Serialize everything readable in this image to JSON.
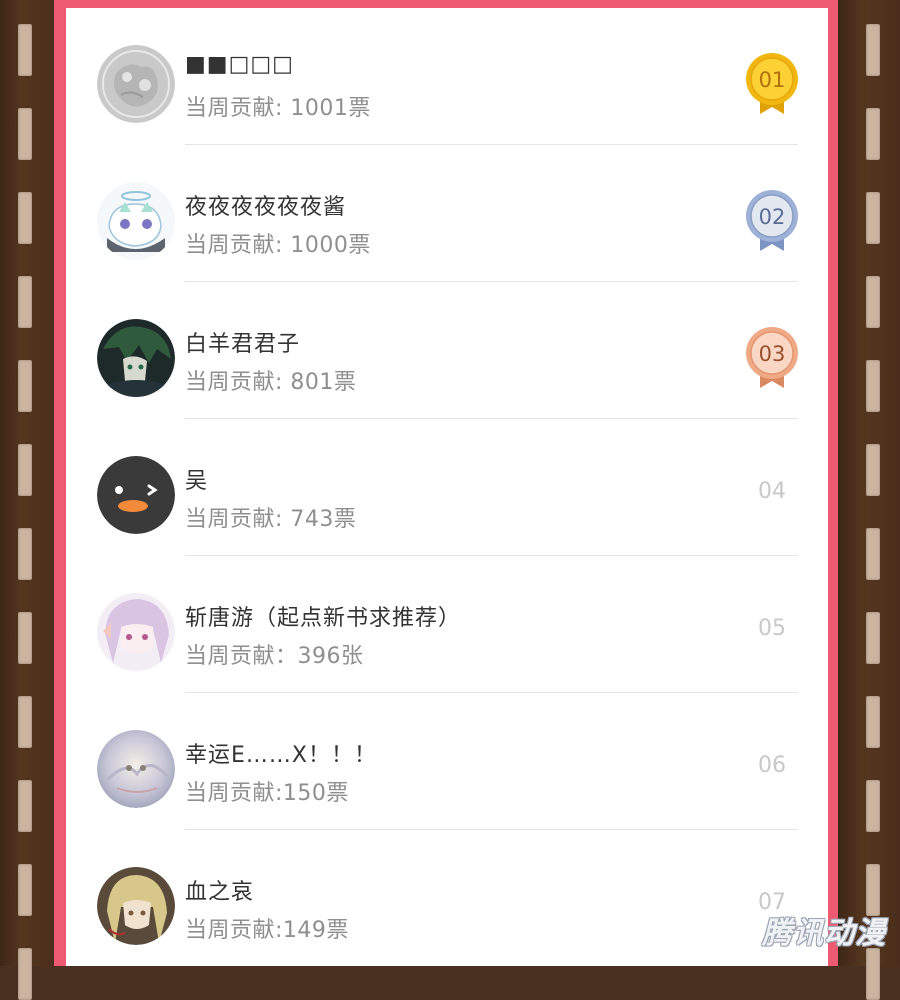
{
  "ranking": [
    {
      "rank": "01",
      "name": "■■□□□",
      "score": "当周贡献: 1001票",
      "medal": "gold",
      "medal_color": "#f1b60f",
      "avatar": "gray-sketch-avatar"
    },
    {
      "rank": "02",
      "name": "夜夜夜夜夜夜酱",
      "score": "当周贡献: 1000票",
      "medal": "silver",
      "medal_color": "#8a9ec6",
      "avatar": "chibi-ghost-avatar"
    },
    {
      "rank": "03",
      "name": "白羊君君子",
      "score": "当周贡献: 801票",
      "medal": "bronze",
      "medal_color": "#e3966f",
      "avatar": "green-hair-character-avatar"
    },
    {
      "rank": "04",
      "name": "吴",
      "score": "当周贡献: 743票",
      "medal": "none",
      "avatar": "dark-face-avatar"
    },
    {
      "rank": "05",
      "name": "斩唐游（起点新书求推荐）",
      "score": "当周贡献：396张",
      "medal": "none",
      "avatar": "pink-hair-girl-avatar"
    },
    {
      "rank": "06",
      "name": "幸运E……X！！！",
      "score": "当周贡献:150票",
      "medal": "none",
      "avatar": "cat-painting-avatar"
    },
    {
      "rank": "07",
      "name": "血之哀",
      "score": "当周贡献:149票",
      "medal": "none",
      "avatar": "blonde-character-avatar"
    }
  ],
  "watermark": "腾讯动漫",
  "colors": {
    "frame": "#ee5a72",
    "film": "#4a3020",
    "film_hole": "#cbb4a0",
    "rank_text": "#c8c8c8"
  }
}
